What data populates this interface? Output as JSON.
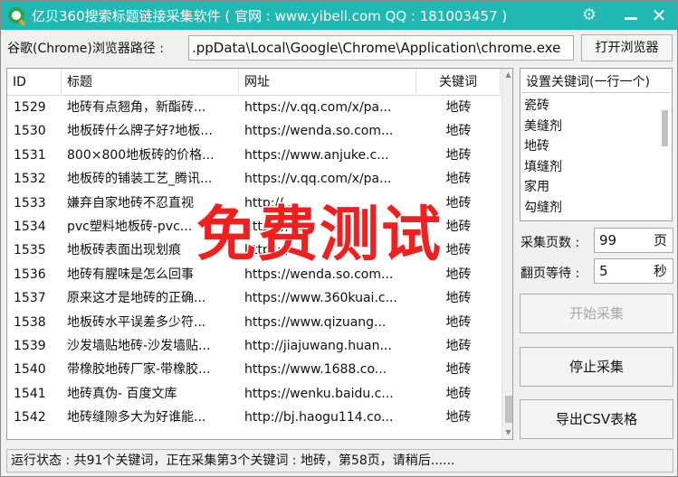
{
  "window": {
    "title": "亿贝360搜索标题链接采集软件 ( 官网 : www.yibell.com QQ : 181003457 )",
    "close_glyph": "✕",
    "settings_glyph": "⚙"
  },
  "path": {
    "label": "谷歌(Chrome)浏览器路径 :",
    "value": ".ppData\\Local\\Google\\Chrome\\Application\\chrome.exe",
    "open_button": "打开浏览器"
  },
  "table": {
    "columns": [
      "ID",
      "标题",
      "网址",
      "关键词"
    ],
    "rows": [
      {
        "id": "1529",
        "title": "地砖有点翘角，新酯砖...",
        "url": "https://v.qq.com/x/pa...",
        "kw": "地砖"
      },
      {
        "id": "1530",
        "title": "地板砖什么牌子好?地板...",
        "url": "https://wenda.so.com...",
        "kw": "地砖"
      },
      {
        "id": "1531",
        "title": "800×800地板砖的价格...",
        "url": "https://www.anjuke.c...",
        "kw": "地砖"
      },
      {
        "id": "1532",
        "title": "地板砖的铺装工艺_腾讯...",
        "url": "https://v.qq.com/x/pa...",
        "kw": "地砖"
      },
      {
        "id": "1533",
        "title": "嫌弃自家地砖不忍直视",
        "url": "http://...",
        "kw": "地砖"
      },
      {
        "id": "1534",
        "title": "pvc塑料地板砖-pvc...",
        "url": "https://...",
        "kw": "地砖"
      },
      {
        "id": "1535",
        "title": "地板砖表面出现划痕",
        "url": "https://...",
        "kw": "地砖"
      },
      {
        "id": "1536",
        "title": "地砖有腥味是怎么回事",
        "url": "https://wenda.so.com...",
        "kw": "地砖"
      },
      {
        "id": "1537",
        "title": "原来这才是地砖的正确...",
        "url": "https://www.360kuai.c...",
        "kw": "地砖"
      },
      {
        "id": "1538",
        "title": "地板砖水平误差多少符...",
        "url": "https://www.qizuang...",
        "kw": "地砖"
      },
      {
        "id": "1539",
        "title": "沙发墙贴地砖-沙发墙贴...",
        "url": "http://jiajuwang.huan...",
        "kw": "地砖"
      },
      {
        "id": "1540",
        "title": "带橡胶地砖厂家-带橡胶...",
        "url": "https://www.1688.co...",
        "kw": "地砖"
      },
      {
        "id": "1541",
        "title": "地砖真伪- 百度文库",
        "url": "https://wenku.baidu.c...",
        "kw": "地砖"
      },
      {
        "id": "1542",
        "title": "地砖缝隙多大为好谁能...",
        "url": "http://bj.haogu114.co...",
        "kw": "地砖"
      }
    ]
  },
  "keywords": {
    "title": "设置关键词(一行一个)",
    "items": [
      "瓷砖",
      "美缝剂",
      "地砖",
      "填缝剂",
      "家用",
      "勾缝剂"
    ]
  },
  "settings": {
    "pages_label": "采集页数 :",
    "pages_value": "99",
    "pages_unit": "页",
    "wait_label": "翻页等待 :",
    "wait_value": "5",
    "wait_unit": "秒"
  },
  "buttons": {
    "start": "开始采集",
    "stop": "停止采集",
    "export": "导出CSV表格"
  },
  "status": {
    "text": "运行状态 : 共91个关键词，正在采集第3个关键词 : 地砖，第58页，请稍后......"
  },
  "watermark": {
    "text": "免费测试"
  },
  "colors": {
    "titlebar": "#1fb8b2",
    "watermark": "#f02020"
  }
}
